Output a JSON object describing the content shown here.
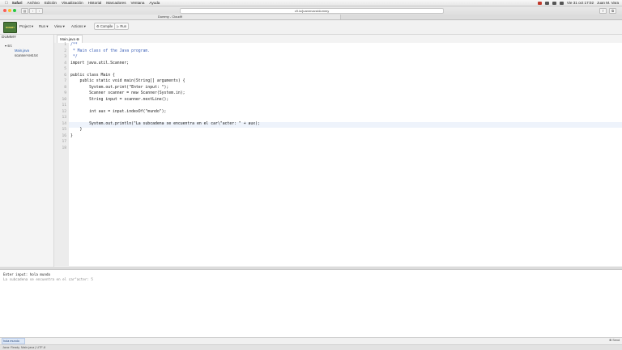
{
  "menubar": {
    "app": "Safari",
    "menus": [
      "Archivo",
      "Edición",
      "Visualización",
      "Historial",
      "Marcadores",
      "Ventana",
      "Ayuda"
    ],
    "clock": "Vie 31 oct  17:02",
    "user": "Juan M. Vara"
  },
  "browser": {
    "url": "c9.io/juanmvara/dummy",
    "tabs": [
      {
        "label": "Dummy - Cloud9"
      },
      {
        "label": ""
      }
    ]
  },
  "ide": {
    "logo": "DUMMY",
    "menus": [
      "Project ▾",
      "Run ▾",
      "View ▾",
      "Actions ▾"
    ],
    "buttons": [
      "⚙ Compile",
      "▷ Run"
    ]
  },
  "sidebar": {
    "title": "DUMMY",
    "items": [
      "▾ src",
      "Main.java",
      "scanner-test.txt"
    ]
  },
  "editor": {
    "tab": "Main.java ⊗",
    "lines": [
      "/**",
      " * Main class of the Java program.",
      " */",
      "import java.util.Scanner;",
      "",
      "public class Main {",
      "    public static void main(String[] arguments) {",
      "        System.out.print(\"Enter input: \");",
      "        Scanner scanner = new Scanner(System.in);",
      "        String input = scanner.nextLine();",
      "",
      "        int aux = input.indexOf(\"mundo\");",
      "",
      "        System.out.println(\"La subcadena se encuentra en el car\\\"acter: \" + aux);",
      "    }",
      "}",
      "",
      ""
    ],
    "highlight_line": 14
  },
  "console": {
    "lines": [
      "Enter input: hola mundo",
      "La subcadena se encuentra en el car\"acter: 5"
    ],
    "input_label": "hola mundo",
    "send": "⊗ Send"
  },
  "status": {
    "left": "Java: Ready",
    "mid": "Main.java  |  UTF-8"
  }
}
